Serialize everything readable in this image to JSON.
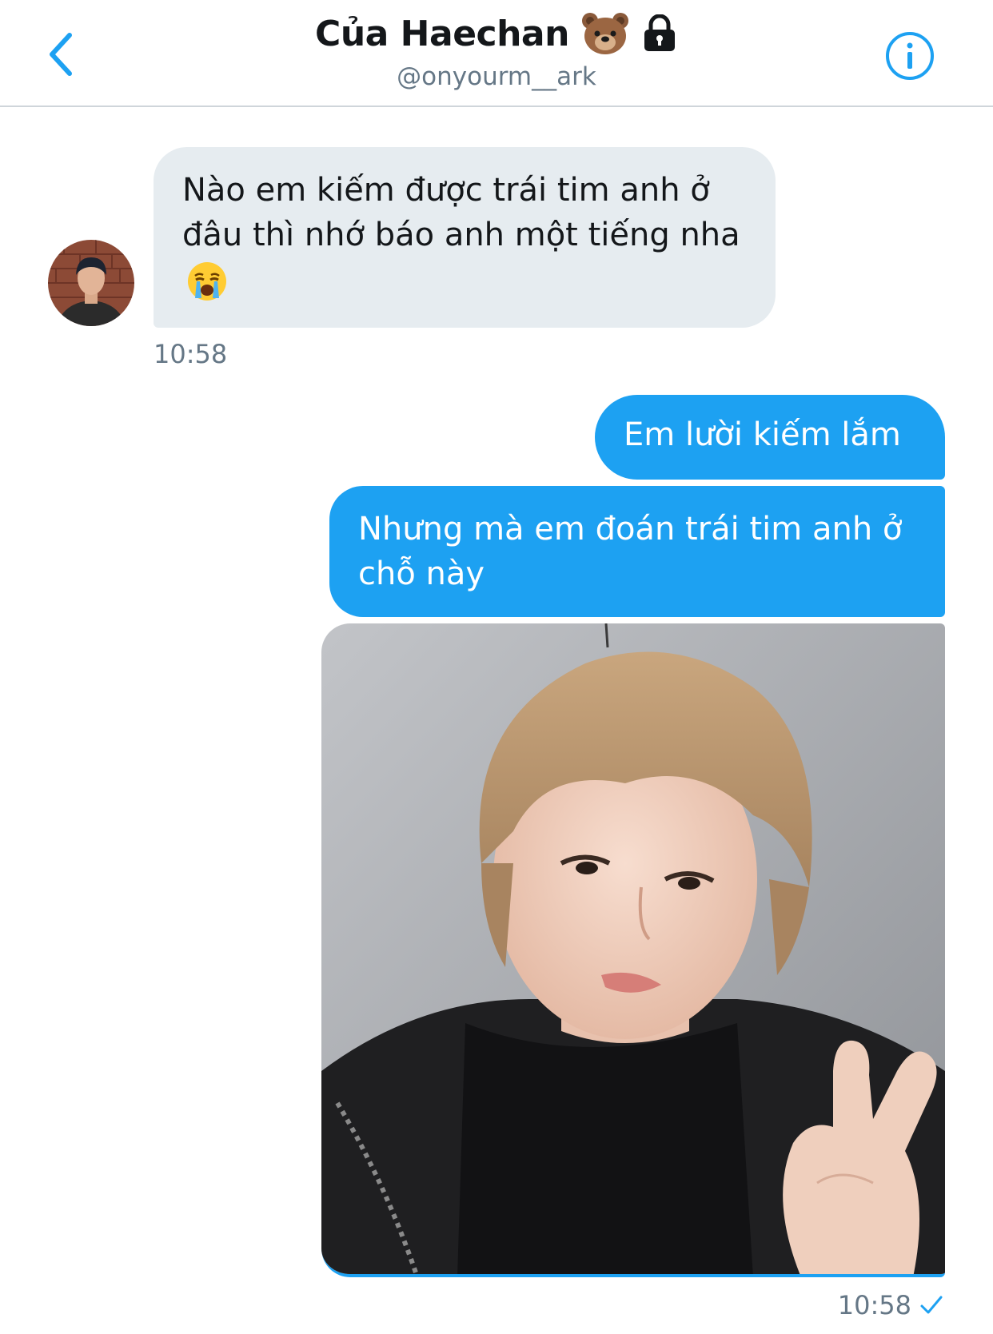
{
  "header": {
    "title": "Của Haechan",
    "handle": "@onyourm__ark",
    "icons": [
      "back-chevron-icon",
      "bear-emoji-icon",
      "lock-icon",
      "info-icon"
    ]
  },
  "conversation": {
    "messages": [
      {
        "direction": "incoming",
        "text": "Nào em kiếm được trái tim anh ở đâu thì nhớ báo anh một tiếng nha",
        "emoji": "crying-face-emoji",
        "time": "10:58"
      },
      {
        "direction": "outgoing",
        "text": "Em lười kiếm lắm"
      },
      {
        "direction": "outgoing",
        "text": "Nhưng mà em đoán trái tim anh ở chỗ này"
      },
      {
        "direction": "outgoing",
        "type": "photo",
        "time": "10:58",
        "status": "read-check-icon"
      }
    ]
  },
  "colors": {
    "accent": "#1da1f2",
    "incoming_bubble": "#e6ecf0",
    "muted_text": "#657786",
    "divider": "#cfd5da"
  }
}
